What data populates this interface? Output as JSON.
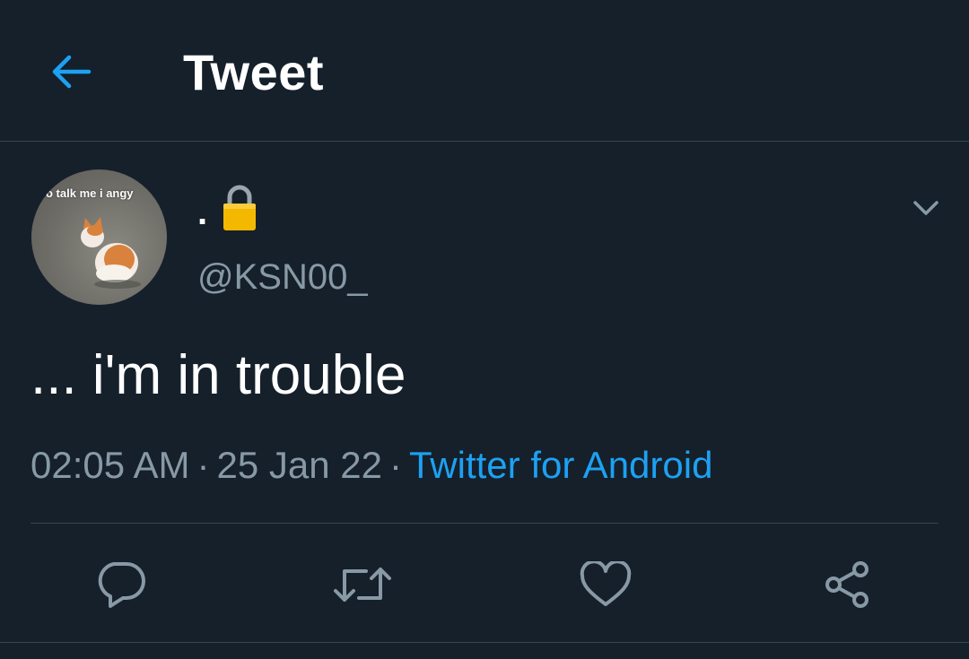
{
  "header": {
    "title": "Tweet",
    "back_icon": "arrow-left-icon"
  },
  "tweet": {
    "avatar_caption": "o talk me i angy",
    "display_name": ".",
    "lock_icon": "lock-icon",
    "handle": "@KSN00_",
    "text": "... i'm in trouble",
    "time": "02:05 AM",
    "separator": "·",
    "date": "25 Jan 22",
    "source": "Twitter for Android"
  },
  "actions": {
    "reply_icon": "reply-icon",
    "retweet_icon": "retweet-icon",
    "like_icon": "heart-icon",
    "share_icon": "share-icon"
  },
  "colors": {
    "background": "#15202b",
    "accent": "#1da1f2",
    "secondary_text": "#8899a6",
    "divider": "#38444d"
  }
}
